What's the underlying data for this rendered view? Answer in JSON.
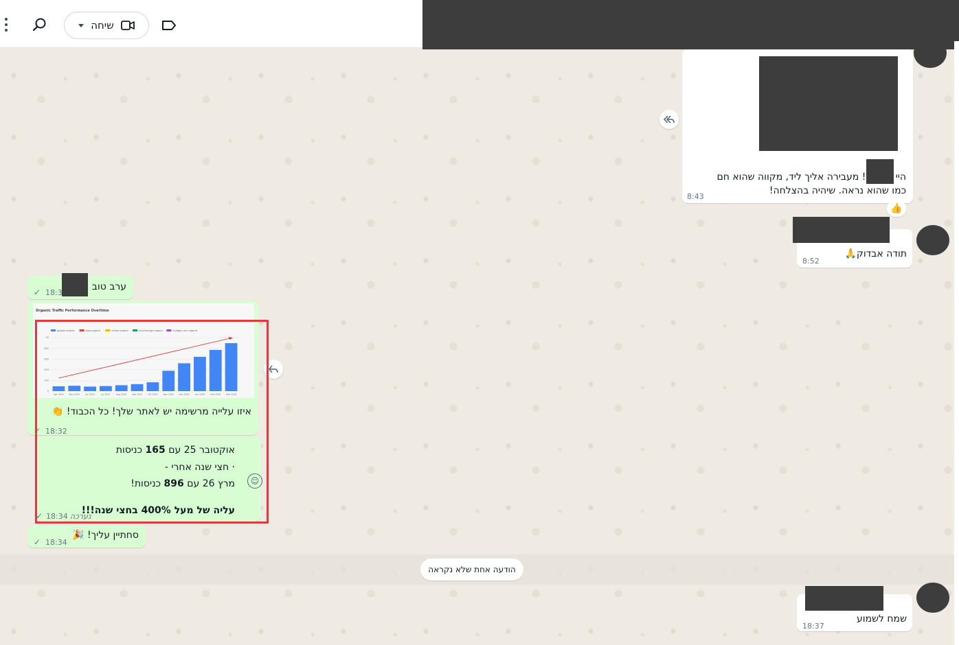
{
  "header": {
    "call_label": "שיחה"
  },
  "messages": {
    "in1": {
      "text_line1": "היי ג שמח! מעבירה אליך ליד, מקווה שהוא חם",
      "text_line2": "כמו שהוא נראה. שיהיה בהצלחה!",
      "time": "8:43",
      "reaction": "👍"
    },
    "in2": {
      "text": "תודה אבדוק🙏",
      "time": "8:52"
    },
    "out1": {
      "text": "ערב טוב",
      "time": "18:3"
    },
    "out2": {
      "caption": "איזו עלייה מרשימה יש לאתר שלך! כל הכבוד! 👏",
      "time": "18:32"
    },
    "out3": {
      "line1_pre": "אוקטובר 25 עם ",
      "line1_bold": "165",
      "line1_post": " כניסות",
      "line2": "· חצי שנה אחרי -",
      "line3_pre": "מרץ 26 עם ",
      "line3_bold": "896",
      "line3_post": " כניסות!",
      "line4_bold": "עליה של מעל 400% בחצי שנה!!!",
      "time": "18:34",
      "status": "נערכה"
    },
    "out4": {
      "text": "סחתיין עליך! 🎉",
      "time": "18:34"
    },
    "in3": {
      "text": "שמח לשמוע",
      "time": "18:37"
    }
  },
  "unread": "הודעה אחת שלא נקראה",
  "chart_data": {
    "type": "bar",
    "title": "Organic Traffic Performance Overtime",
    "legend": [
      "google organic",
      "bing organic",
      "yahoo organic",
      "duckduckgo organic",
      "chatgpt.com organic"
    ],
    "legend_colors": [
      "#4285f4",
      "#db4437",
      "#f4b400",
      "#0f9d58",
      "#ab47bc"
    ],
    "categories": [
      "Apr 2025",
      "May 2025",
      "Jun 2025",
      "Jul 2025",
      "Aug 2025",
      "Sep 2025",
      "Oct 2025",
      "Nov 2025",
      "Dec 2025",
      "Jan 2026",
      "Feb 2026",
      "Mar 2026"
    ],
    "values": [
      90,
      100,
      85,
      95,
      110,
      130,
      165,
      380,
      520,
      640,
      770,
      896
    ],
    "ylim": [
      0,
      1000
    ],
    "yticks": [
      "0",
      "200",
      "400",
      "600",
      "800",
      "1K"
    ],
    "trendline": true
  }
}
